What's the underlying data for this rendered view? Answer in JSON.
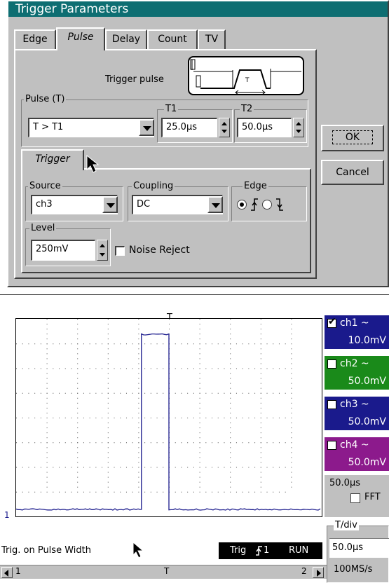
{
  "dialog": {
    "title": "Trigger Parameters",
    "tabs": [
      "Edge",
      "Pulse",
      "Delay",
      "Count",
      "TV"
    ],
    "active_tab": "Pulse",
    "trigger_pulse_label": "Trigger pulse",
    "trigger_pulse_diagram_label": "T",
    "pulse_group": {
      "label": "Pulse (T)",
      "condition_value": "T > T1",
      "t1_label": "T1",
      "t1_value": "25.0µs",
      "t2_label": "T2",
      "t2_value": "50.0µs"
    },
    "trigger_tab": "Trigger",
    "source": {
      "label": "Source",
      "value": "ch3"
    },
    "coupling": {
      "label": "Coupling",
      "value": "DC"
    },
    "edge": {
      "label": "Edge",
      "selected": "rising"
    },
    "level": {
      "label": "Level",
      "value": "250mV"
    },
    "noise_reject": {
      "label": "Noise Reject",
      "checked": false
    },
    "ok_label": "OK",
    "cancel_label": "Cancel"
  },
  "scope": {
    "trigger_marker": "T",
    "trigger_level_marker": "T",
    "channel_marker": "1",
    "status_text": "Trig. on Pulse Width",
    "trig_label": "Trig",
    "trig_source": "1",
    "run_label": "RUN",
    "scroll_left_label": "1",
    "scroll_mid_label": "T",
    "scroll_right_label": "2",
    "channels": [
      {
        "name": "ch1 ~",
        "value": "10.0mV",
        "color": "#1a1a8c",
        "checked": true
      },
      {
        "name": "ch2 ~",
        "value": "50.0mV",
        "color": "#1a8a1a",
        "checked": false
      },
      {
        "name": "ch3 ~",
        "value": "50.0mV",
        "color": "#1a1a8c",
        "checked": false
      },
      {
        "name": "ch4 ~",
        "value": "50.0mV",
        "color": "#8c1a8c",
        "checked": false
      }
    ],
    "timebase_value": "50.0µs",
    "fft_label": "FFT",
    "tdiv_label": "T/div",
    "tdiv_value": "50.0µs",
    "sample_rate": "100MS/s",
    "trace_color": "#1a1a8c",
    "waveform": {
      "baseline": 0,
      "pulse_high": 1,
      "pulse_start_div": 4.1,
      "pulse_end_div": 5.0,
      "divisions": 10
    }
  }
}
